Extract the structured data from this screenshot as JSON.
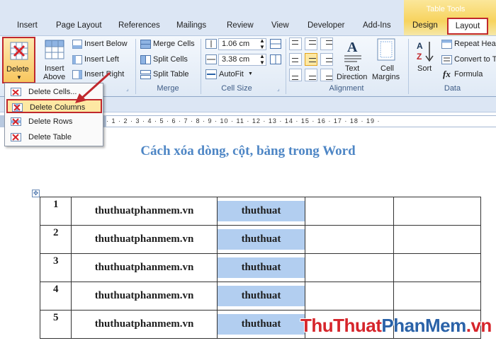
{
  "tabs": [
    "Insert",
    "Page Layout",
    "References",
    "Mailings",
    "Review",
    "View",
    "Developer",
    "Add-Ins",
    "Design",
    "Layout"
  ],
  "context_tab_label": "Table Tools",
  "ribbon": {
    "delete_label": "Delete",
    "insert_above": [
      "Insert",
      "Above"
    ],
    "insert_below": "Insert Below",
    "insert_left": "Insert Left",
    "insert_right": "Insert Right",
    "merge_cells": "Merge Cells",
    "split_cells": "Split Cells",
    "split_table": "Split Table",
    "merge_group": "Merge",
    "row_height": "1.06 cm",
    "col_width": "3.38 cm",
    "autofit": "AutoFit",
    "cell_size_group": "Cell Size",
    "text_direction": [
      "Text",
      "Direction"
    ],
    "cell_margins": [
      "Cell",
      "Margins"
    ],
    "alignment_group": "Alignment",
    "sort": "Sort",
    "repeat_header": "Repeat Hea",
    "convert_to": "Convert to T",
    "formula": "Formula",
    "data_group": "Data"
  },
  "delete_menu": [
    "Delete Cells...",
    "Delete Columns",
    "Delete Rows",
    "Delete Table"
  ],
  "ruler_text": "· 1 · 2 · 3 · 4 · 5 · 6 · 7 · 8 · 9 · 10 · 11 · 12 · 13 · 14 · 15 · 16 · 17 · 18 · 19 ·",
  "doc_title": "Cách xóa dòng, cột, bảng trong Word",
  "table_rows": [
    {
      "num": "1",
      "site": "thuthuatphanmem.vn",
      "word": "thuthuat"
    },
    {
      "num": "2",
      "site": "thuthuatphanmem.vn",
      "word": "thuthuat"
    },
    {
      "num": "3",
      "site": "thuthuatphanmem.vn",
      "word": "thuthuat"
    },
    {
      "num": "4",
      "site": "thuthuatphanmem.vn",
      "word": "thuthuat"
    },
    {
      "num": "5",
      "site": "thuthuatphanmem.vn",
      "word": "thuthuat"
    }
  ],
  "watermark": {
    "part1": "ThuThuat",
    "part2": "PhanMem",
    "part3": ".vn"
  },
  "colors": {
    "accent_red": "#c0282d",
    "highlight": "#b2cef0",
    "title_blue": "#4e86c5"
  }
}
